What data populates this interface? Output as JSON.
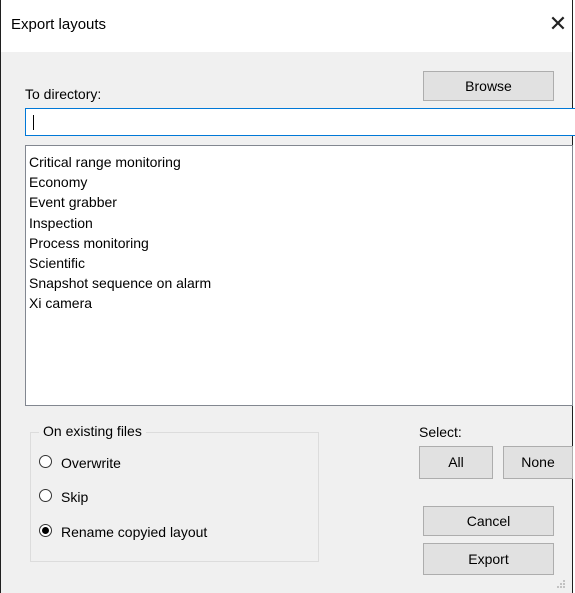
{
  "window": {
    "title": "Export layouts"
  },
  "directory": {
    "label": "To directory:",
    "browse_label": "Browse",
    "value": ""
  },
  "layouts": [
    "Critical range monitoring",
    "Economy",
    "Event grabber",
    "Inspection",
    "Process monitoring",
    "Scientific",
    "Snapshot sequence on alarm",
    "Xi camera"
  ],
  "existing_files": {
    "legend": "On existing files",
    "options": [
      {
        "label": "Overwrite",
        "checked": false
      },
      {
        "label": "Skip",
        "checked": false
      },
      {
        "label": "Rename copyied layout",
        "checked": true
      }
    ]
  },
  "select": {
    "label": "Select:",
    "all_label": "All",
    "none_label": "None"
  },
  "actions": {
    "cancel_label": "Cancel",
    "export_label": "Export"
  },
  "icons": {
    "close": "close-icon",
    "radio": "radio-icon",
    "resize_grip": "resize-grip-icon"
  }
}
